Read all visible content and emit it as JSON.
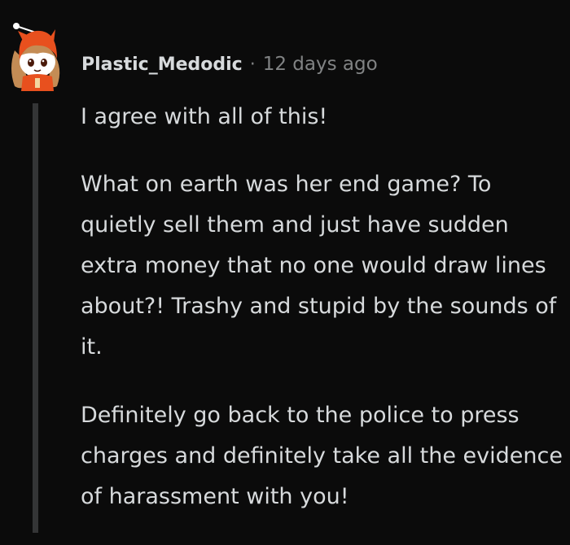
{
  "comment": {
    "author": "Plastic_Medodic",
    "separator": "·",
    "timestamp": "12 days ago",
    "avatar_icon": "snoo-avatar-icon",
    "paragraphs": [
      "I agree with all of this!",
      "What on earth was her end game? To quietly sell them and just have sudden extra money that no one would draw lines about?! Trashy and stupid by the sounds of it.",
      "Definitely go back to the police to press charges and definitely take all the evidence of harassment with you!"
    ]
  },
  "colors": {
    "background": "#0b0b0b",
    "text": "#d7dadc",
    "meta": "#818384",
    "thread_line": "#343536",
    "avatar_hood": "#e8501e"
  }
}
